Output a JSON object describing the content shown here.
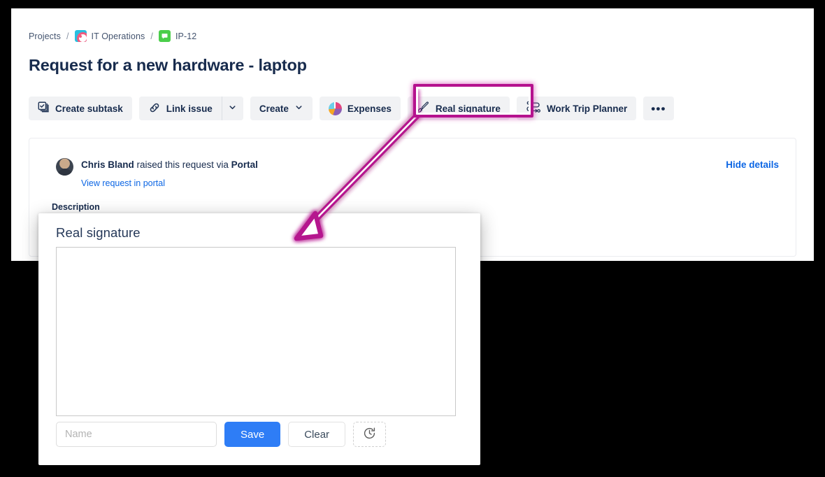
{
  "breadcrumb": {
    "projects_label": "Projects",
    "separator": "/",
    "project_label": "IT Operations",
    "project_icon": "it-operations-project-icon",
    "issue_key": "IP-12",
    "issue_icon": "service-request-icon"
  },
  "page_title": "Request for a new hardware - laptop",
  "toolbar": {
    "create_subtask": {
      "label": "Create subtask",
      "icon": "create-subtask-icon"
    },
    "link_issue": {
      "label": "Link issue",
      "icon": "link-icon",
      "caret_icon": "chevron-down-icon"
    },
    "create": {
      "label": "Create",
      "caret_icon": "chevron-down-icon"
    },
    "expenses": {
      "label": "Expenses",
      "icon": "pie-chart-icon"
    },
    "real_signature": {
      "label": "Real signature",
      "icon": "signature-pen-icon"
    },
    "work_trip_planner": {
      "label": "Work Trip Planner",
      "icon": "route-path-icon"
    },
    "more": {
      "label": "•••",
      "icon": "more-actions-icon"
    }
  },
  "activity": {
    "reporter": "Chris Bland",
    "raised_text": " raised this request via ",
    "channel": "Portal",
    "portal_link": "View request in portal",
    "hide_details": "Hide details",
    "description_label": "Description",
    "description_body": ""
  },
  "modal": {
    "title": "Real signature",
    "canvas_name": "signature-drawing-canvas",
    "name_input_value": "",
    "name_input_placeholder": "Name",
    "save_label": "Save",
    "clear_label": "Clear",
    "history_icon": "clock-restore-icon"
  },
  "annotation": {
    "highlight_target": "real-signature-button",
    "highlight_color": "#B5128E",
    "arrow": "callout-arrow-from-button-to-modal"
  },
  "colors": {
    "accent_blue": "#0C66E4",
    "save_blue": "#2E7DF6",
    "text": "#172B4D",
    "annotation_magenta": "#B5128E"
  }
}
